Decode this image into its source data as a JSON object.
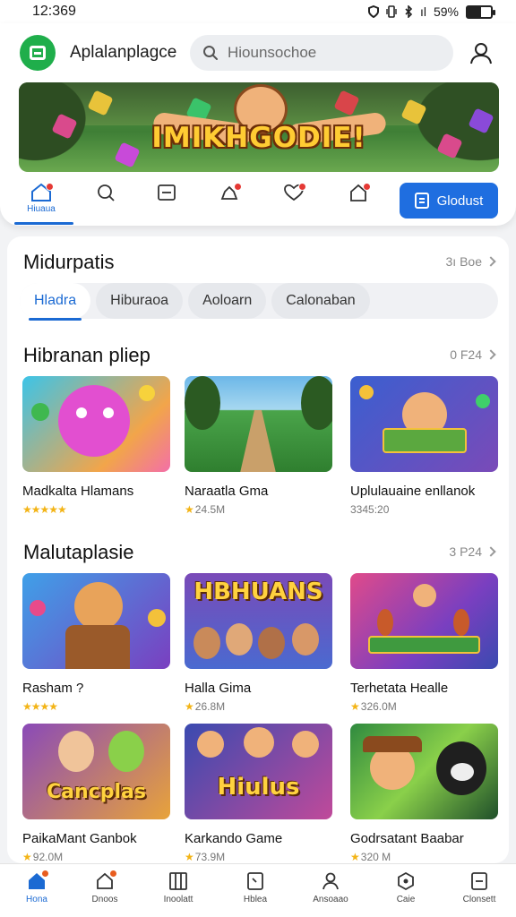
{
  "status_bar": {
    "time": "12:369",
    "signal_text": "ıl",
    "battery": "59%",
    "battery_level": 0.59
  },
  "header": {
    "app_title": "Aplalanplagce",
    "search_placeholder": "Hiounsochoe",
    "banner_text": "IMIKHGODIE!",
    "nav": {
      "home_label": "Hiuaua",
      "cta_label": "Glodust"
    }
  },
  "section1": {
    "title": "Midurpatis",
    "see_all": "3ı Boe",
    "tabs": [
      "Hladra",
      "Hiburaoa",
      "Aoloarn",
      "Calonaban"
    ],
    "active_tab": 0
  },
  "section2": {
    "title": "Hibranan pliep",
    "see_all": "0 F24",
    "cards": [
      {
        "title": "Madkalta Hlamans",
        "meta": "",
        "stars": 5
      },
      {
        "title": "Naraatla Gma",
        "meta": "24.5M",
        "stars": 1
      },
      {
        "title": "Uplulauaine enllanok",
        "meta": "3345:20",
        "stars": 0
      }
    ]
  },
  "section3": {
    "title": "Malutaplasie",
    "see_all": "3 P24",
    "cards": [
      {
        "title": "Rasham ?",
        "meta": "",
        "stars": 4,
        "thumb_word": ""
      },
      {
        "title": "Halla Gima",
        "meta": "26.8M",
        "stars": 1,
        "thumb_word": "HBHUANS"
      },
      {
        "title": "Terhetata Healle",
        "meta": "326.0M",
        "stars": 1,
        "thumb_word": ""
      },
      {
        "title": "PaikaMant Ganbok",
        "meta": "92.0M",
        "stars": 1,
        "thumb_word": "Cancplas"
      },
      {
        "title": "Karkando Game",
        "meta": "73.9M",
        "stars": 1,
        "thumb_word": "Hiulus"
      },
      {
        "title": "Godrsatant Baabar",
        "meta": "320 M",
        "stars": 1,
        "thumb_word": ""
      }
    ]
  },
  "bottom_nav": [
    {
      "label": "Hona",
      "icon": "home-icon",
      "badge": true,
      "active": true
    },
    {
      "label": "Dnoos",
      "icon": "cloud-icon",
      "badge": true,
      "active": false
    },
    {
      "label": "Inoolatt",
      "icon": "library-icon",
      "badge": false,
      "active": false
    },
    {
      "label": "Hblea",
      "icon": "book-icon",
      "badge": false,
      "active": false
    },
    {
      "label": "Ansoaao",
      "icon": "person-icon",
      "badge": false,
      "active": false
    },
    {
      "label": "Caie",
      "icon": "hexagon-icon",
      "badge": false,
      "active": false
    },
    {
      "label": "Clonsett",
      "icon": "document-icon",
      "badge": false,
      "active": false
    }
  ],
  "colors": {
    "accent": "#1b6ad3",
    "brand": "#1fae4b",
    "badge": "#e53935",
    "star": "#f3b416"
  }
}
